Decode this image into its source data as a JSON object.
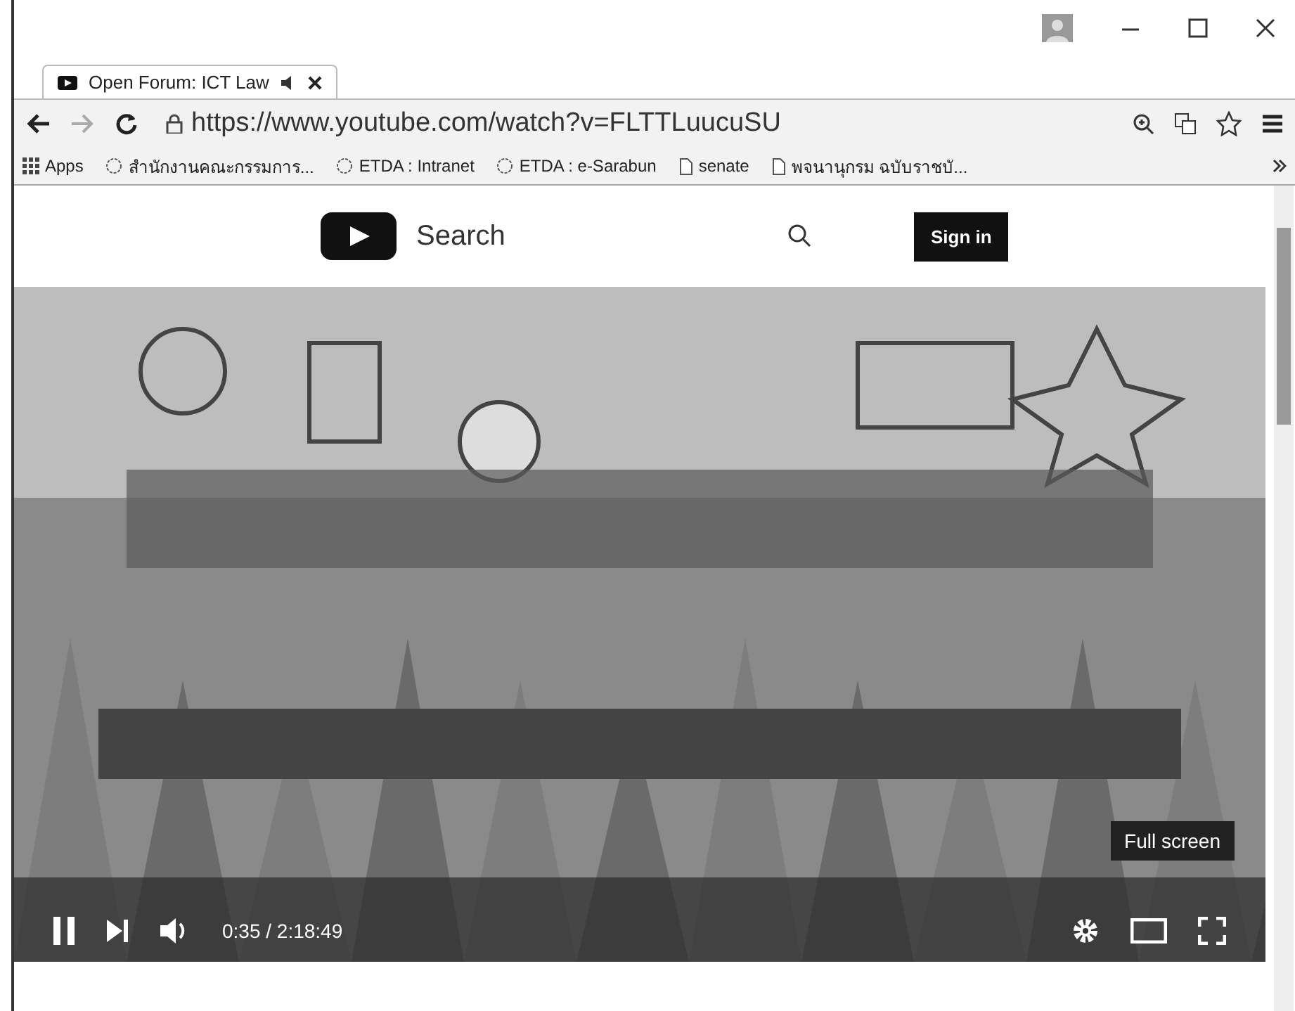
{
  "tab": {
    "title": "Open Forum: ICT Law",
    "selected": true
  },
  "address_bar": {
    "url": "https://www.youtube.com/watch?v=FLTTLuucuSU"
  },
  "bookmarks": [
    {
      "label": "Apps",
      "kind": "apps"
    },
    {
      "label": "สำนักงานคณะกรรมการ...",
      "kind": "site"
    },
    {
      "label": "ETDA : Intranet",
      "kind": "site"
    },
    {
      "label": "ETDA : e-Sarabun",
      "kind": "site"
    },
    {
      "label": "senate",
      "kind": "page"
    },
    {
      "label": "พจนานุกรม ฉบับราชบั...",
      "kind": "page"
    }
  ],
  "header": {
    "search": {
      "placeholder": "Search"
    },
    "sign_in": "Sign in"
  },
  "player": {
    "kind": "picture",
    "playing": true,
    "time": "0:35 / 2:18:49",
    "tooltip": "Full screen"
  }
}
